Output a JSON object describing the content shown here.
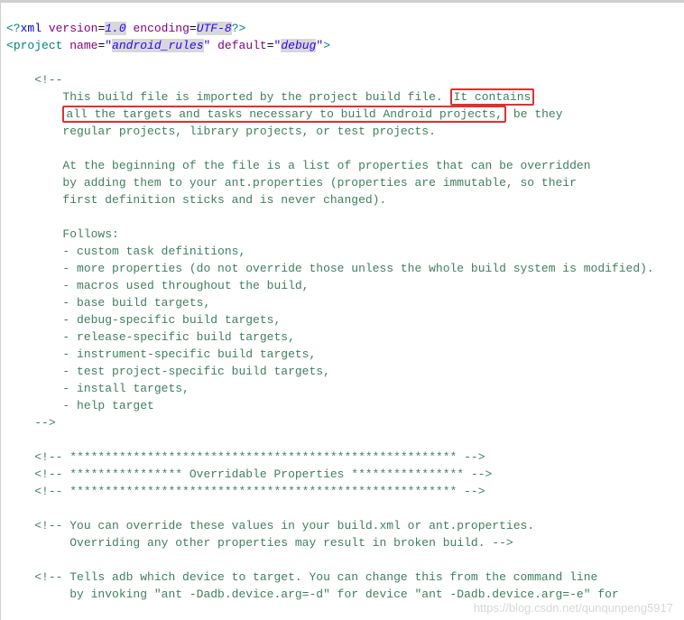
{
  "xmlpi": {
    "version": "1.0",
    "encoding": "UTF-8"
  },
  "project": {
    "name": "android_rules",
    "default": "debug"
  },
  "comment_main": {
    "open": "<!--",
    "l1a": "This build file is imported by the project build file.",
    "l1b": "It contains",
    "l2a": "all the targets and tasks necessary to build Android projects,",
    "l2b": " be they",
    "l3": "regular projects, library projects, or test projects.",
    "l4": "At the beginning of the file is a list of properties that can be overridden",
    "l5": "by adding them to your ant.properties (properties are immutable, so their",
    "l6": "first definition sticks and is never changed).",
    "l7": "Follows:",
    "l8": "- custom task definitions,",
    "l9": "- more properties (do not override those unless the whole build system is modified).",
    "l10": "- macros used throughout the build,",
    "l11": "- base build targets,",
    "l12": "- debug-specific build targets,",
    "l13": "- release-specific build targets,",
    "l14": "- instrument-specific build targets,",
    "l15": "- test project-specific build targets,",
    "l16": "- install targets,",
    "l17": "- help target",
    "close": "-->"
  },
  "sep1": "<!-- ******************************************************* -->",
  "hdr": "<!-- **************** Overridable Properties **************** -->",
  "sep2": "<!-- ******************************************************* -->",
  "override1": "<!-- You can override these values in your build.xml or ant.properties.",
  "override2": "     Overriding any other properties may result in broken build. -->",
  "adb1": "<!-- Tells adb which device to target. You can change this from the command line",
  "adb2": "     by invoking \"ant -Dadb.device.arg=-d\" for device \"ant -Dadb.device.arg=-e\" for",
  "watermark": "https://blog.csdn.net/qunqunpeng5917"
}
